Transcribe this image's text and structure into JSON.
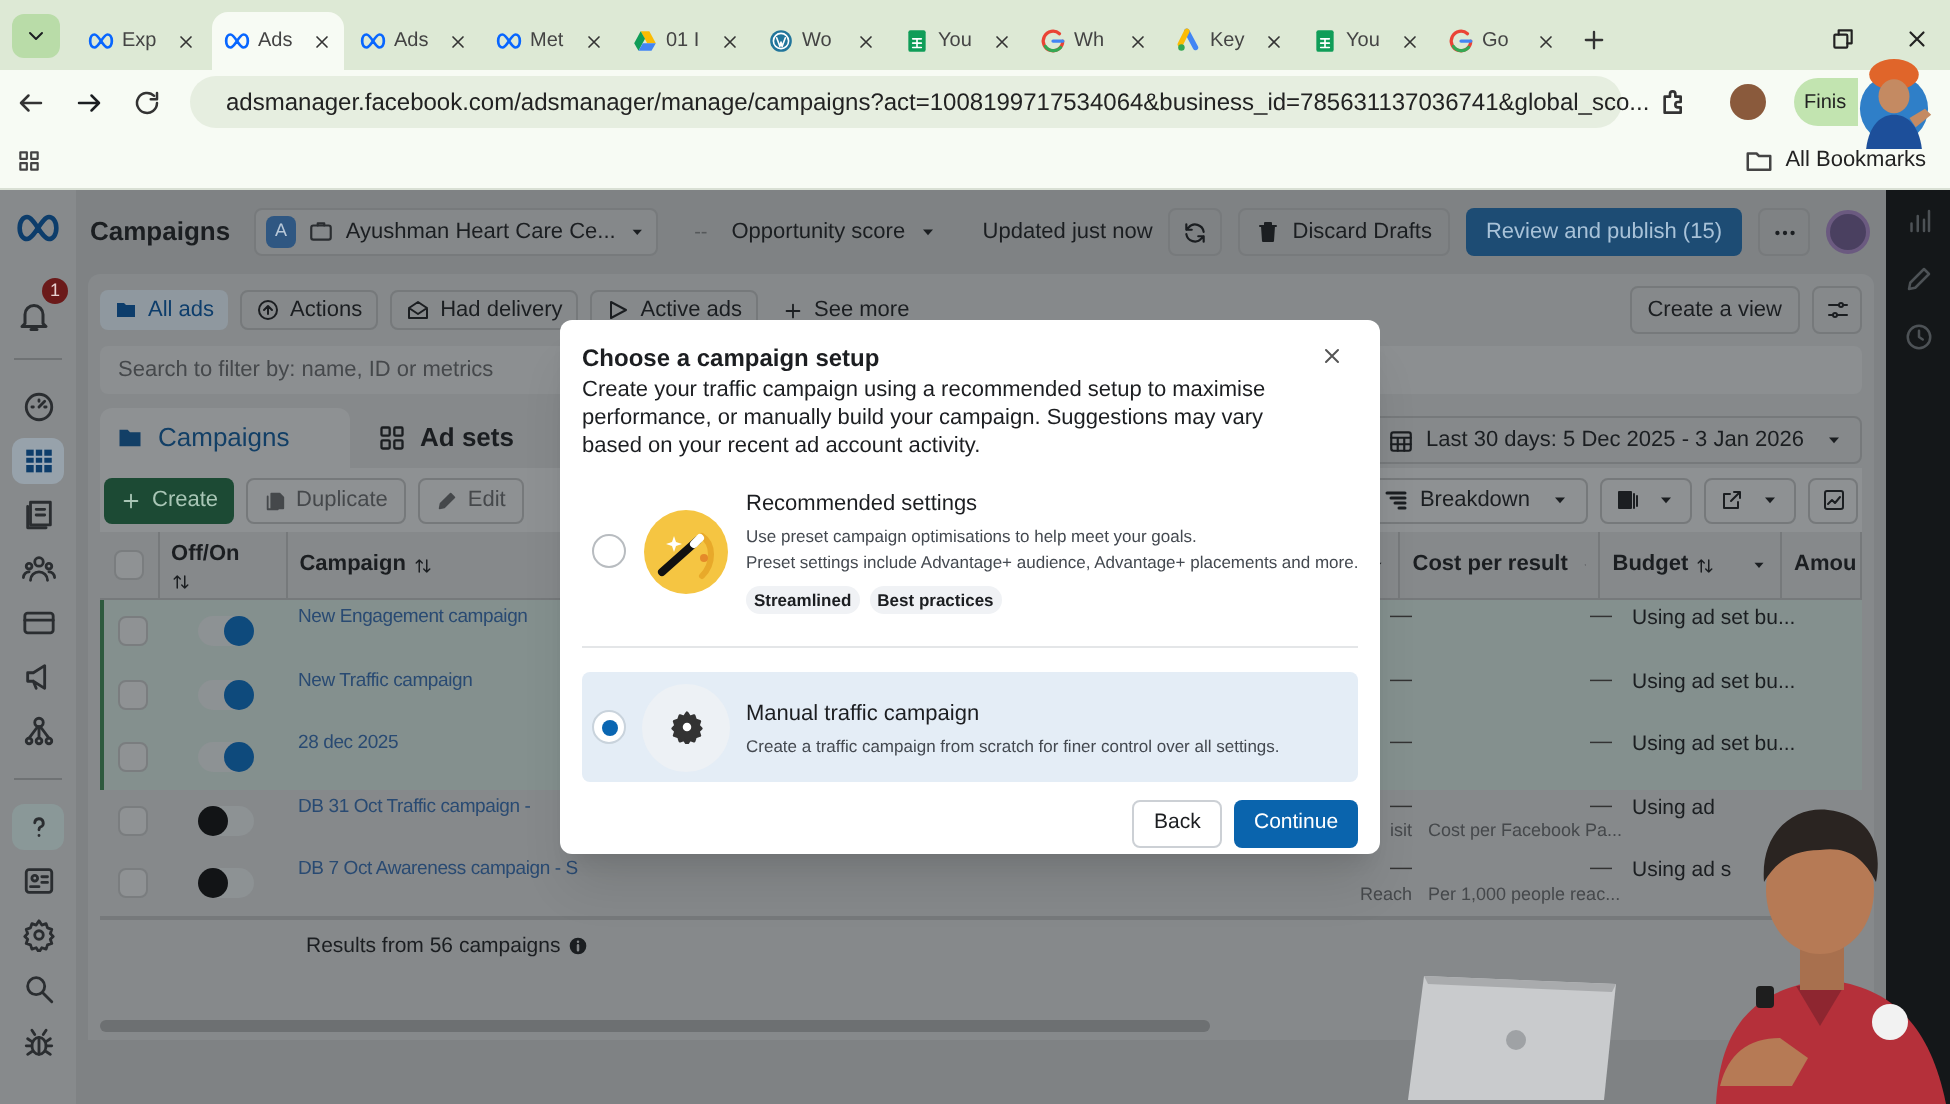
{
  "browser": {
    "tabs": [
      {
        "kind": "meta",
        "label": "Exp",
        "selected": false
      },
      {
        "kind": "meta",
        "label": "Ads",
        "selected": true
      },
      {
        "kind": "meta",
        "label": "Ads",
        "selected": false
      },
      {
        "kind": "meta",
        "label": "Met",
        "selected": false
      },
      {
        "kind": "drive",
        "label": "01 I",
        "selected": false
      },
      {
        "kind": "wordpress",
        "label": "Wo",
        "selected": false
      },
      {
        "kind": "sheets",
        "label": "You",
        "selected": false
      },
      {
        "kind": "google",
        "label": "Wh",
        "selected": false
      },
      {
        "kind": "ads",
        "label": "Key",
        "selected": false
      },
      {
        "kind": "sheets",
        "label": "You",
        "selected": false
      },
      {
        "kind": "google",
        "label": "Go",
        "selected": false
      }
    ],
    "url": "adsmanager.facebook.com/adsmanager/manage/campaigns?act=1008199717534064&business_id=785631137036741&global_sco...",
    "profile_button": "Finis",
    "bookmarks": "All Bookmarks"
  },
  "header": {
    "title": "Campaigns",
    "account_badge": "A",
    "account_name": "Ayushman Heart Care Ce...",
    "opportunity_prefix": "--",
    "opportunity": "Opportunity score",
    "updated": "Updated just now",
    "discard": "Discard Drafts",
    "publish": "Review and publish (15)"
  },
  "notifications": "1",
  "sidebar": [
    {
      "kind": "dashboard",
      "selected": false,
      "divider_before": true
    },
    {
      "kind": "table",
      "selected": true
    },
    {
      "kind": "pages",
      "selected": false
    },
    {
      "kind": "audience",
      "selected": false
    },
    {
      "kind": "billing",
      "selected": false
    },
    {
      "kind": "megaphone",
      "selected": false
    },
    {
      "kind": "network",
      "selected": false
    },
    {
      "kind": "help",
      "selected": false,
      "divider_before": true
    },
    {
      "kind": "id",
      "selected": false
    },
    {
      "kind": "settings",
      "selected": false
    },
    {
      "kind": "search",
      "selected": false
    },
    {
      "kind": "bug",
      "selected": false
    }
  ],
  "filters": [
    {
      "kind": "folder",
      "label": "All ads",
      "selected": true
    },
    {
      "kind": "actions",
      "label": "Actions",
      "selected": false
    },
    {
      "kind": "mail",
      "label": "Had delivery",
      "selected": false
    },
    {
      "kind": "play",
      "label": "Active ads",
      "selected": false
    }
  ],
  "see_more": "See more",
  "create_view": "Create a view",
  "search_placeholder": "Search to filter by: name, ID or metrics",
  "level_tabs": [
    {
      "kind": "campaigns",
      "label": "Campaigns",
      "selected": true
    },
    {
      "kind": "adsets",
      "label": "Ad sets",
      "selected": false
    }
  ],
  "date_range": "Last 30 days: 5 Dec 2025 - 3 Jan 2026",
  "toolbar": {
    "create": "Create",
    "duplicate": "Duplicate",
    "edit": "Edit",
    "breakdown": "Breakdown"
  },
  "table": {
    "columns": [
      {
        "kind": "toggle",
        "label": "Off/On"
      },
      {
        "kind": "name",
        "label": "Campaign"
      },
      {
        "kind": "results"
      },
      {
        "kind": "cost",
        "label": "Cost per result"
      },
      {
        "kind": "budget",
        "label": "Budget"
      },
      {
        "kind": "amount",
        "label": "Amou"
      }
    ],
    "rows": [
      {
        "selected": true,
        "on": true,
        "name": "New Engagement campaign",
        "results": "—",
        "cost": "—",
        "budget": "Using ad set bu..."
      },
      {
        "selected": true,
        "on": true,
        "name": "New Traffic campaign",
        "results": "—",
        "cost": "—",
        "budget": "Using ad set bu..."
      },
      {
        "selected": true,
        "on": true,
        "name": "28 dec 2025",
        "results": "—",
        "cost": "—",
        "budget": "Using ad set bu..."
      },
      {
        "selected": false,
        "on": false,
        "name": "DB 31 Oct Traffic campaign -",
        "results": "—",
        "result_type": "isit",
        "cost": "—",
        "cost_note": "Cost per Facebook Pa...",
        "budget": "Using ad"
      },
      {
        "selected": false,
        "on": false,
        "name": "DB 7 Oct Awareness campaign - S",
        "results": "—",
        "result_type": "Reach",
        "cost": "—",
        "cost_note": "Per 1,000 people reac...",
        "budget": "Using ad s"
      }
    ],
    "footer": "Results from 56 campaigns",
    "select_all_checked": false
  },
  "modal": {
    "title": "Choose a campaign setup",
    "description": "Create your traffic campaign using a recommended setup to maximise performance, or manually build your campaign. Suggestions may vary based on your recent ad account activity.",
    "options": [
      {
        "kind": "recommended",
        "selected": false,
        "title": "Recommended settings",
        "lines": [
          "Use preset campaign optimisations to help meet your goals.",
          "Preset settings include Advantage+ audience, Advantage+ placements and more."
        ],
        "tags": [
          "Streamlined",
          "Best practices"
        ]
      },
      {
        "kind": "manual",
        "selected": true,
        "title": "Manual traffic campaign",
        "lines": [
          "Create a traffic campaign from scratch for finer control over all settings."
        ]
      }
    ],
    "buttons": [
      {
        "kind": "secondary",
        "label": "Back"
      },
      {
        "kind": "primary",
        "label": "Continue"
      }
    ]
  }
}
